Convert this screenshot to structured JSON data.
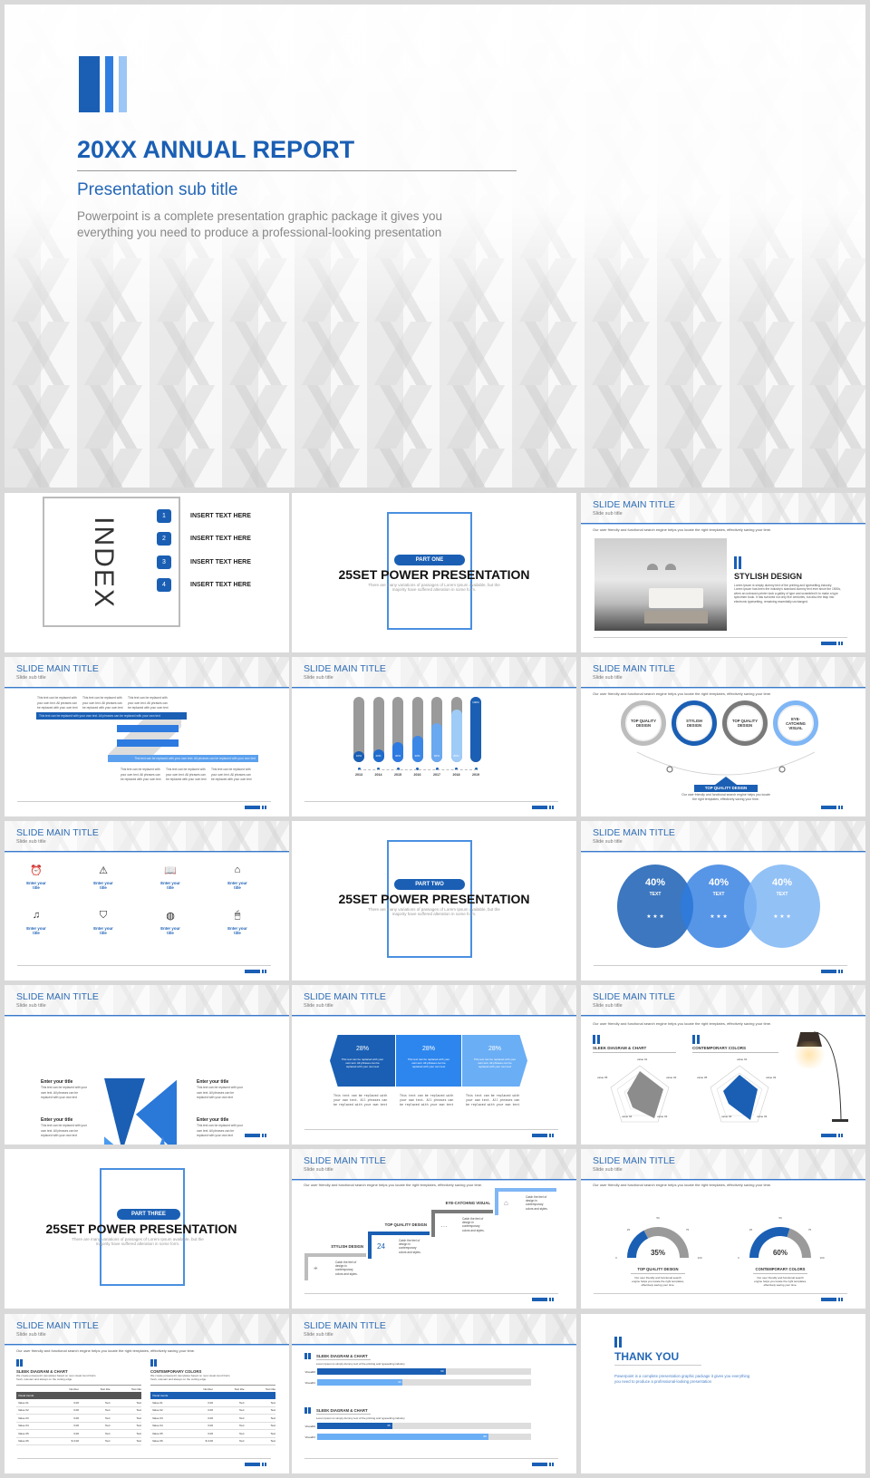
{
  "cover": {
    "title": "20XX ANNUAL REPORT",
    "subtitle": "Presentation sub title",
    "description_1": "Powerpoint is a complete presentation graphic package it gives you",
    "description_2": "everything you need to produce a professional-looking presentation"
  },
  "colors": {
    "primary": "#1a5fb4",
    "mid": "#3b87e6",
    "light": "#7fb6f5",
    "gray": "#9a9a9a"
  },
  "common": {
    "slide_title": "SLIDE MAIN TITLE",
    "slide_subtitle": "Slide sub title",
    "intro": "Our user friendly and functional search engine helps you locate the right templates, effectively saving your time.",
    "lorem": "This text can be replaced with your own text. All phrases can be replaced with your own text",
    "catch": "Catch the feel of design in contemporary colors and styles."
  },
  "index": {
    "title": "INDEX",
    "items": [
      {
        "n": "1",
        "label": "INSERT TEXT HERE"
      },
      {
        "n": "2",
        "label": "INSERT TEXT HERE"
      },
      {
        "n": "3",
        "label": "INSERT TEXT HERE"
      },
      {
        "n": "4",
        "label": "INSERT TEXT HERE"
      }
    ]
  },
  "parts": {
    "one": "PART ONE",
    "two": "PART TWO",
    "three": "PART THREE",
    "title": "25SET POWER PRESENTATION",
    "body": "There are many variations of passages of Lorem Ipsum available, but the majority have suffered alteration in some form."
  },
  "stylish": {
    "heading": "STYLISH DESIGN",
    "body": "Lorem Ipsum is simply dummy text of the printing and typesetting industry. Lorem Ipsum has been the industry's standard dummy text ever since the 1500s, when an unknown printer took a galley of type and scrambled it to make a type specimen book. It has survived not only five centuries, but also the leap into electronic typesetting, remaining essentially unchanged."
  },
  "chart_data": [
    {
      "type": "bar",
      "categories": [
        "2013",
        "2014",
        "2015",
        "2016",
        "2017",
        "2018",
        "2019"
      ],
      "values": [
        10,
        20,
        30,
        40,
        60,
        80,
        100
      ],
      "labels": [
        "10%",
        "20%",
        "30%",
        "40%",
        "60%",
        "80%",
        "100%"
      ],
      "ylim": [
        0,
        100
      ]
    },
    {
      "type": "gauge",
      "items": [
        {
          "value": 35,
          "label": "35%",
          "title": "TOP QUALITY DESIGN"
        },
        {
          "value": 60,
          "label": "60%",
          "title": "CONTEMPORARY COLORS"
        }
      ],
      "ticks": [
        "0",
        "25",
        "50",
        "75",
        "100"
      ],
      "caption": "Our user friendly and functional search engine helps you locate the right templates, effectively saving your time."
    },
    {
      "type": "bar",
      "orientation": "horizontal",
      "groups": [
        {
          "title": "SLEEK DIAGRAM & CHART",
          "caption": "Lorem Ipsum is simply dummy text of the printing and typesetting industry",
          "bars": [
            {
              "name": "Visual02",
              "value": 60
            },
            {
              "name": "Visual01",
              "value": 40
            }
          ]
        },
        {
          "title": "SLEEK DIAGRAM & CHART",
          "caption": "Lorem Ipsum is simply dummy text of the printing and typesetting industry",
          "bars": [
            {
              "name": "Visual02",
              "value": 35
            },
            {
              "name": "Visual01",
              "value": 80
            }
          ]
        }
      ],
      "xlim": [
        0,
        100
      ]
    }
  ],
  "rings": {
    "items": [
      "TOP QUALITY DESIGN",
      "STYLISH DESIGN",
      "TOP QUALITY DESIGN",
      "EYE-CATCHING VISUAL"
    ],
    "badge": "TOP QUALITY DESIGN",
    "caption": "Our user friendly and functional search engine helps you locate the right templates, effectively saving your time."
  },
  "icons": {
    "items": [
      {
        "icon": "alarm-clock-icon",
        "glyph": "⏰",
        "label": "Enter your title"
      },
      {
        "icon": "warning-icon",
        "glyph": "⚠",
        "label": "Enter your title"
      },
      {
        "icon": "book-icon",
        "glyph": "📖",
        "label": "Enter your title"
      },
      {
        "icon": "house-icon",
        "glyph": "⌂",
        "label": "Enter your title"
      },
      {
        "icon": "music-note-icon",
        "glyph": "♫",
        "label": "Enter your title"
      },
      {
        "icon": "shield-icon",
        "glyph": "⛉",
        "label": "Enter your title"
      },
      {
        "icon": "globe-icon",
        "glyph": "◍",
        "label": "Enter your title"
      },
      {
        "icon": "mouse-icon",
        "glyph": "🖱",
        "label": "Enter your title"
      }
    ]
  },
  "circles": {
    "value": "40%",
    "text": "TEXT",
    "stars": "★ ★ ★"
  },
  "triangles": {
    "title": "Enter your title"
  },
  "hexes": {
    "value": "28%"
  },
  "radar": {
    "left_title": "SLEEK DIAGRAM & CHART",
    "right_title": "CONTEMPORARY COLORS",
    "labels": [
      "value 01",
      "value 02",
      "value 03",
      "value 04",
      "value 05"
    ]
  },
  "steps": [
    {
      "label": "STYLISH DESIGN",
      "icon": "location-pin-icon"
    },
    {
      "label": "TOP QUALITY DESIGN",
      "icon": "calendar-icon",
      "glyph": "24"
    },
    {
      "label": "EYE-CATCHING VISUAL",
      "icon": "chat-icon"
    },
    {
      "label": "",
      "icon": "house-icon"
    }
  ],
  "tables": {
    "left_title": "SLEEK DIAGRAM & CHART",
    "right_title": "CONTEMPORARY COLORS",
    "caption": "We create powerpoint (templates based on new visual trend that's fresh, relevant and always on the cutting edge.",
    "headers": [
      "",
      "Number",
      "Test title",
      "Test title"
    ],
    "group": "Visual trends",
    "rows": [
      [
        "Value 01",
        "3.00",
        "Text",
        "Text"
      ],
      [
        "Value 02",
        "3.00",
        "Text",
        "Text"
      ],
      [
        "Value 03",
        "3.00",
        "Text",
        "Text"
      ],
      [
        "Value 04",
        "3.00",
        "Text",
        "Text"
      ],
      [
        "Value 05",
        "3.00",
        "Text",
        "Text"
      ],
      [
        "Value 06",
        "$ 3.00",
        "Text",
        "Text"
      ]
    ]
  },
  "thanks": {
    "title": "THANK YOU",
    "body_1": "Powerpoint is a complete presentation graphic package it gives you everything",
    "body_2": "you need to produce a professional-looking presentation"
  }
}
